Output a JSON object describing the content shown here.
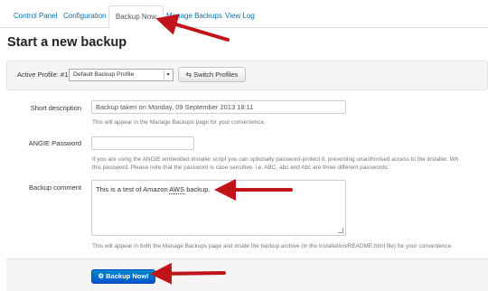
{
  "tabs": [
    {
      "label": "Control Panel"
    },
    {
      "label": "Configuration"
    },
    {
      "label": "Backup Now"
    },
    {
      "label": "Manage Backups"
    },
    {
      "label": "View Log"
    }
  ],
  "page_title": "Start a new backup",
  "profile": {
    "label": "Active Profile: #1",
    "selected": "Default Backup Profile",
    "switch_label": "Switch Profiles"
  },
  "form": {
    "description_label": "Short description",
    "description_value": "Backup taken on Monday, 09 September 2013 18:11",
    "description_help": "This will appear in the Manage Backups page for your convenience.",
    "angie_label": "ANGIE Password",
    "angie_value": "",
    "angie_help_1": "If you are using the ANGIE embedded installer script you can optionally password-protect it, preventing unauthorised access to the installer. Wh",
    "angie_help_2": "this password. Please note that the password is case sensitive, i.e. ABC, abc and Abc are three different passwords.",
    "comment_label": "Backup comment",
    "comment_before": "This is a test of Amazon ",
    "comment_word": "AWS",
    "comment_after": " backup.",
    "comment_help": "This will appear in both the Manage Backups page and inside the backup archive (in the installation/README.html file) for your convenience."
  },
  "action": {
    "backup_label": "Backup Now!"
  },
  "colors": {
    "accent": "#0a6fb0",
    "primary_button": "#0066cc",
    "annotation_arrow": "#c0141a"
  },
  "icons": {
    "switch": "switch-arrows-icon",
    "caret": "chevron-down-icon",
    "backup": "robot-icon"
  }
}
